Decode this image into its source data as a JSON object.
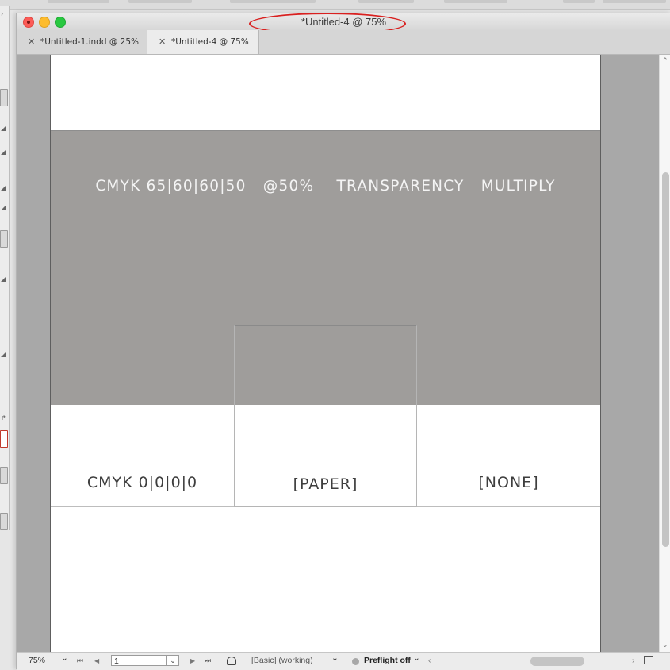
{
  "window": {
    "title": "*Untitled-4 @ 75%"
  },
  "tabs": [
    {
      "close": "✕",
      "label": "*Untitled-1.indd @ 25%",
      "active": false
    },
    {
      "close": "✕",
      "label": "*Untitled-4 @ 75%",
      "active": true
    }
  ],
  "document": {
    "banner_text": "CMYK 65|60|60|50   @50%    TRANSPARENCY   MULTIPLY",
    "swatches": [
      {
        "label": "CMYK 0|0|0|0"
      },
      {
        "label": "[PAPER]"
      },
      {
        "label": "[NONE]"
      }
    ]
  },
  "statusbar": {
    "zoom": "75%",
    "zoom_caret": "⌄",
    "first_page": "⏮",
    "prev_page": "◀",
    "page_number": "1",
    "page_drop": "⌄",
    "next_page": "▶",
    "last_page": "⏭",
    "profile": "[Basic] (working)",
    "profile_caret": "⌄",
    "preflight": "Preflight off",
    "preflight_caret": "⌄",
    "scroll_left": "‹",
    "scroll_right": "›"
  },
  "scroll": {
    "up": "⌃",
    "down": "⌄"
  },
  "colors": {
    "highlight_ellipse": "#d9201f",
    "gray_fill": "#9f9d9b"
  }
}
